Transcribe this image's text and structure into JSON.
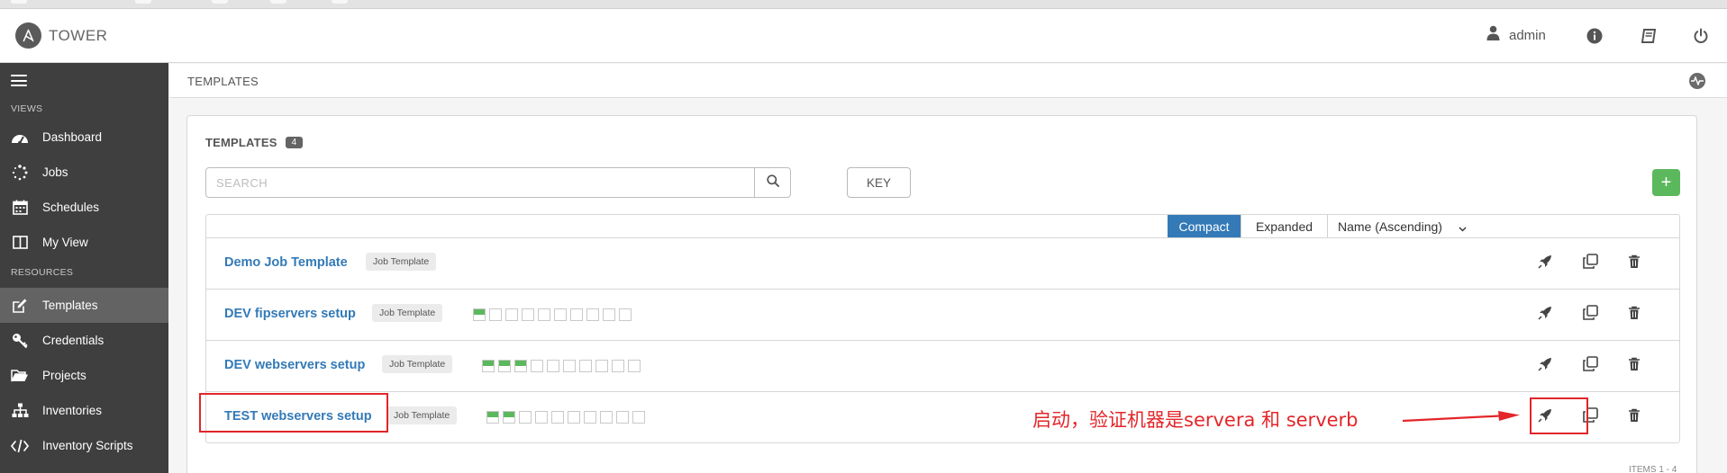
{
  "app": {
    "logo_text": "TOWER",
    "user_name": "admin"
  },
  "colors": {
    "accent_blue": "#337ab7",
    "success_green": "#5cb85c",
    "annotation_red": "#e3262b"
  },
  "sidebar": {
    "sections": {
      "views": "VIEWS",
      "resources": "RESOURCES"
    },
    "items": [
      {
        "label": "Dashboard",
        "icon": "dashboard-icon",
        "active": false
      },
      {
        "label": "Jobs",
        "icon": "jobs-spinner-icon",
        "active": false
      },
      {
        "label": "Schedules",
        "icon": "calendar-icon",
        "active": false
      },
      {
        "label": "My View",
        "icon": "columns-icon",
        "active": false
      },
      {
        "label": "Templates",
        "icon": "edit-icon",
        "active": true
      },
      {
        "label": "Credentials",
        "icon": "key-icon",
        "active": false
      },
      {
        "label": "Projects",
        "icon": "folder-icon",
        "active": false
      },
      {
        "label": "Inventories",
        "icon": "sitemap-icon",
        "active": false
      },
      {
        "label": "Inventory Scripts",
        "icon": "code-icon",
        "active": false
      }
    ]
  },
  "header": {
    "title": "TEMPLATES"
  },
  "panel": {
    "title": "TEMPLATES",
    "count": "4",
    "search_placeholder": "SEARCH",
    "key_label": "KEY",
    "add_label": "+"
  },
  "toolbar": {
    "compact_label": "Compact",
    "expanded_label": "Expanded",
    "sort_label": "Name (Ascending)",
    "view_selected": "Compact"
  },
  "templates": [
    {
      "name": "Demo Job Template",
      "type": "Job Template",
      "jobs_ok": 0,
      "jobs_total": 0
    },
    {
      "name": "DEV fipservers setup",
      "type": "Job Template",
      "jobs_ok": 1,
      "jobs_total": 10
    },
    {
      "name": "DEV webservers setup",
      "type": "Job Template",
      "jobs_ok": 3,
      "jobs_total": 10
    },
    {
      "name": "TEST webservers setup",
      "type": "Job Template",
      "jobs_ok": 2,
      "jobs_total": 10
    }
  ],
  "annotation": {
    "text": "启动，验证机器是servera 和 serverb"
  },
  "footer": {
    "items_text": "ITEMS 1 - 4"
  }
}
